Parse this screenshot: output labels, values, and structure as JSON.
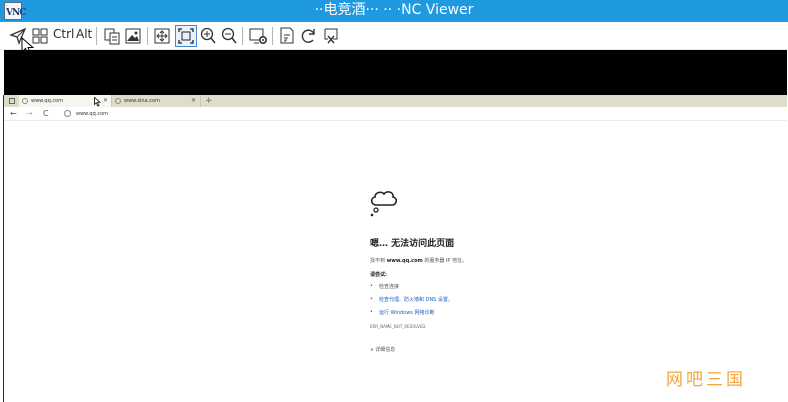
{
  "window": {
    "title": "··电竞酒··· ·· ·NC Viewer",
    "logo_text": "VNC",
    "logo_top": "·"
  },
  "toolbar": {
    "ctrl_label": "Ctrl",
    "alt_label": "Alt",
    "icons": [
      "send-arrow-icon",
      "grid-icon",
      "copy-icon",
      "image-icon",
      "fullscreen-icon",
      "fit-window-icon",
      "zoom-in-icon",
      "zoom-out-icon",
      "settings-icon",
      "file-icon",
      "refresh-icon",
      "disconnect-icon"
    ]
  },
  "browser": {
    "tabs": [
      {
        "label": "www.qq.com",
        "active": true
      },
      {
        "label": "www.sina.com",
        "active": false
      }
    ],
    "new_tab": "+",
    "address": "www.qq.com",
    "nav": {
      "back": "←",
      "forward": "→",
      "reload": "C"
    }
  },
  "error_page": {
    "title": "嗯… 无法访问此页面",
    "line_prefix": "找不到",
    "line_domain": "www.qq.com",
    "line_suffix": "的服务器 IP 地址。",
    "try_label": "请尝试:",
    "suggestions": [
      {
        "text": "检查连接",
        "link": false
      },
      {
        "text": "检查代理、防火墙和 DNS 设置。",
        "link": true
      },
      {
        "text": "运行 Windows 网络诊断",
        "link": true
      }
    ],
    "bullet": "•",
    "error_code": "ERR_NAME_NOT_RESOLVED",
    "details_label": "详细信息",
    "details_chevron": "∨"
  },
  "watermark": "网吧三国",
  "colors": {
    "titlebar": "#1f9ae0",
    "link": "#1a5fc7",
    "watermark": "#f3a43a"
  }
}
